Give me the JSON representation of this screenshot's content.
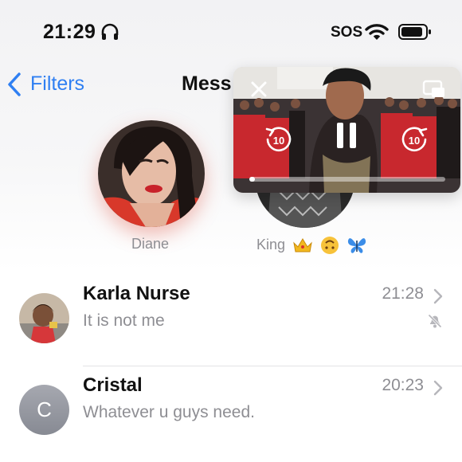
{
  "status_bar": {
    "time": "21:29",
    "headphones_icon": "headphones-icon",
    "sos": "SOS",
    "wifi_icon": "wifi-icon",
    "battery_icon": "battery-icon"
  },
  "nav": {
    "back_label": "Filters",
    "title": "Mess"
  },
  "pinned": [
    {
      "name": "Diane"
    },
    {
      "name": "King",
      "emojis": [
        "crown-emoji",
        "upside-down-face-emoji",
        "butterfly-emoji"
      ]
    }
  ],
  "chats": [
    {
      "name": "Karla Nurse",
      "preview": "It is not me",
      "time": "21:28",
      "muted": true
    },
    {
      "name": "Cristal",
      "preview": "Whatever u guys need.",
      "time": "20:23",
      "avatar_letter": "C",
      "muted": false
    }
  ],
  "pip": {
    "progress_fraction": 0.03,
    "skip_back_seconds": "10",
    "skip_forward_seconds": "10",
    "accent": "#ffffff"
  },
  "colors": {
    "link": "#2f7ff2",
    "secondary_text": "#8e8e93"
  }
}
